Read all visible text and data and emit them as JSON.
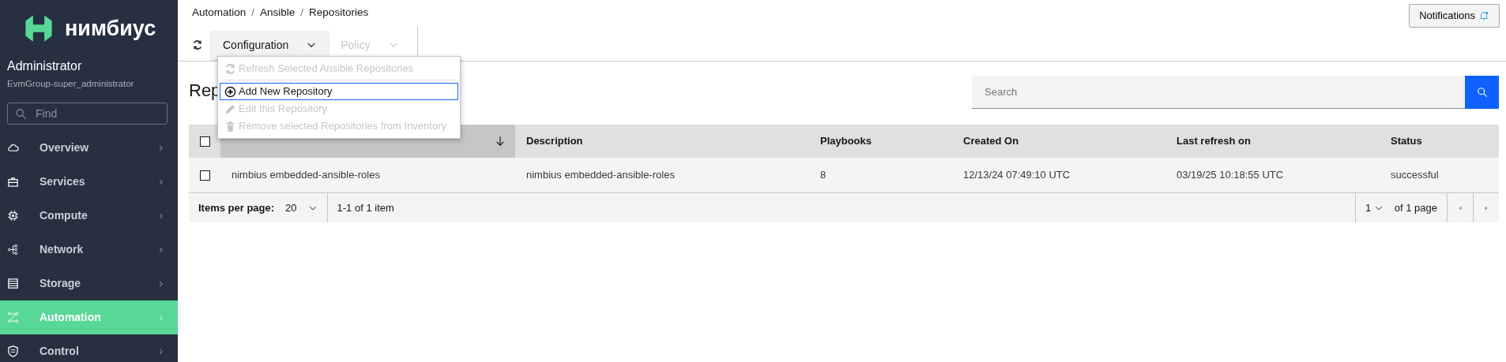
{
  "sidebar": {
    "brand": "нимбиус",
    "user": {
      "name": "Administrator",
      "group": "EvmGroup-super_administrator"
    },
    "find": {
      "placeholder": "Find"
    },
    "items": [
      {
        "label": "Overview",
        "kind": "cloud",
        "selected": false
      },
      {
        "label": "Services",
        "kind": "briefcase",
        "selected": false
      },
      {
        "label": "Compute",
        "kind": "chip",
        "selected": false
      },
      {
        "label": "Network",
        "kind": "network",
        "selected": false
      },
      {
        "label": "Storage",
        "kind": "storage",
        "selected": false
      },
      {
        "label": "Automation",
        "kind": "automation",
        "selected": true
      },
      {
        "label": "Control",
        "kind": "shield",
        "selected": false
      }
    ]
  },
  "breadcrumb": [
    {
      "kind": "link",
      "label": "Automation"
    },
    {
      "kind": "separator",
      "label": "/"
    },
    {
      "kind": "link",
      "label": "Ansible"
    },
    {
      "kind": "separator",
      "label": "/"
    },
    {
      "kind": "link",
      "label": "Repositories"
    }
  ],
  "notifications": "Notifications",
  "toolbar": [
    {
      "label": "Configuration",
      "disabled": false,
      "expanded": true
    },
    {
      "label": "Policy",
      "disabled": true,
      "expanded": false
    }
  ],
  "menu": [
    {
      "label": "Refresh Selected Ansible Repositories",
      "kind": "refresh",
      "disabled": true,
      "focused": false
    },
    {
      "label": "Add New Repository",
      "kind": "add",
      "disabled": false,
      "focused": true
    },
    {
      "label": "Edit this Repository",
      "kind": "edit",
      "disabled": true,
      "focused": false
    },
    {
      "label": "Remove selected Repositories from Inventory",
      "kind": "delete",
      "disabled": true,
      "focused": false
    }
  ],
  "page_title": "Rep",
  "search": {
    "placeholder": "Search"
  },
  "table": {
    "all_checked": false,
    "columns": [
      {
        "sorted": true
      },
      {
        "label": "Description",
        "sorted": false
      },
      {
        "label": "Playbooks",
        "sorted": false
      },
      {
        "label": "Created On",
        "sorted": false
      },
      {
        "label": "Last refresh on",
        "sorted": false
      },
      {
        "label": "Status",
        "sorted": false
      }
    ],
    "rows": [
      {
        "checked": false,
        "cells": [
          "nimbius embedded-ansible-roles",
          "nimbius embedded-ansible-roles",
          "8",
          "12/13/24 07:49:10 UTC",
          "03/19/25 10:18:55 UTC",
          "successful"
        ]
      }
    ]
  },
  "pagination": {
    "items_label": "Items per page:",
    "per_page": "20",
    "range": "1-1 of 1 item",
    "page": "1",
    "of_pages": "of 1 page"
  }
}
